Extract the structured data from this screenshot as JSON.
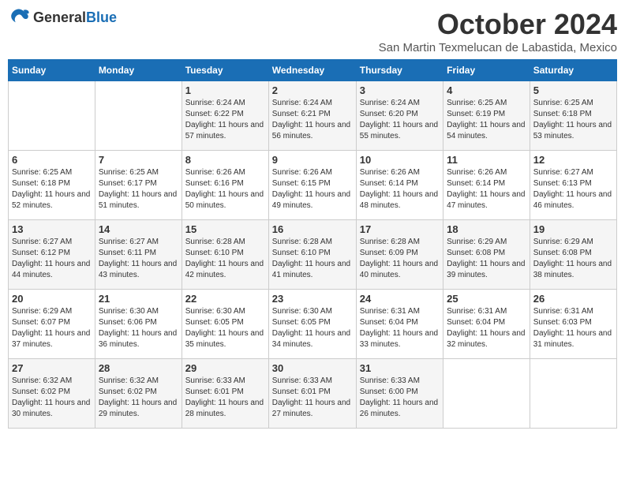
{
  "header": {
    "logo": {
      "general": "General",
      "blue": "Blue"
    },
    "month_year": "October 2024",
    "location": "San Martin Texmelucan de Labastida, Mexico"
  },
  "days_of_week": [
    "Sunday",
    "Monday",
    "Tuesday",
    "Wednesday",
    "Thursday",
    "Friday",
    "Saturday"
  ],
  "weeks": [
    [
      {
        "day": null,
        "info": null
      },
      {
        "day": null,
        "info": null
      },
      {
        "day": "1",
        "info": "Sunrise: 6:24 AM\nSunset: 6:22 PM\nDaylight: 11 hours and 57 minutes."
      },
      {
        "day": "2",
        "info": "Sunrise: 6:24 AM\nSunset: 6:21 PM\nDaylight: 11 hours and 56 minutes."
      },
      {
        "day": "3",
        "info": "Sunrise: 6:24 AM\nSunset: 6:20 PM\nDaylight: 11 hours and 55 minutes."
      },
      {
        "day": "4",
        "info": "Sunrise: 6:25 AM\nSunset: 6:19 PM\nDaylight: 11 hours and 54 minutes."
      },
      {
        "day": "5",
        "info": "Sunrise: 6:25 AM\nSunset: 6:18 PM\nDaylight: 11 hours and 53 minutes."
      }
    ],
    [
      {
        "day": "6",
        "info": "Sunrise: 6:25 AM\nSunset: 6:18 PM\nDaylight: 11 hours and 52 minutes."
      },
      {
        "day": "7",
        "info": "Sunrise: 6:25 AM\nSunset: 6:17 PM\nDaylight: 11 hours and 51 minutes."
      },
      {
        "day": "8",
        "info": "Sunrise: 6:26 AM\nSunset: 6:16 PM\nDaylight: 11 hours and 50 minutes."
      },
      {
        "day": "9",
        "info": "Sunrise: 6:26 AM\nSunset: 6:15 PM\nDaylight: 11 hours and 49 minutes."
      },
      {
        "day": "10",
        "info": "Sunrise: 6:26 AM\nSunset: 6:14 PM\nDaylight: 11 hours and 48 minutes."
      },
      {
        "day": "11",
        "info": "Sunrise: 6:26 AM\nSunset: 6:14 PM\nDaylight: 11 hours and 47 minutes."
      },
      {
        "day": "12",
        "info": "Sunrise: 6:27 AM\nSunset: 6:13 PM\nDaylight: 11 hours and 46 minutes."
      }
    ],
    [
      {
        "day": "13",
        "info": "Sunrise: 6:27 AM\nSunset: 6:12 PM\nDaylight: 11 hours and 44 minutes."
      },
      {
        "day": "14",
        "info": "Sunrise: 6:27 AM\nSunset: 6:11 PM\nDaylight: 11 hours and 43 minutes."
      },
      {
        "day": "15",
        "info": "Sunrise: 6:28 AM\nSunset: 6:10 PM\nDaylight: 11 hours and 42 minutes."
      },
      {
        "day": "16",
        "info": "Sunrise: 6:28 AM\nSunset: 6:10 PM\nDaylight: 11 hours and 41 minutes."
      },
      {
        "day": "17",
        "info": "Sunrise: 6:28 AM\nSunset: 6:09 PM\nDaylight: 11 hours and 40 minutes."
      },
      {
        "day": "18",
        "info": "Sunrise: 6:29 AM\nSunset: 6:08 PM\nDaylight: 11 hours and 39 minutes."
      },
      {
        "day": "19",
        "info": "Sunrise: 6:29 AM\nSunset: 6:08 PM\nDaylight: 11 hours and 38 minutes."
      }
    ],
    [
      {
        "day": "20",
        "info": "Sunrise: 6:29 AM\nSunset: 6:07 PM\nDaylight: 11 hours and 37 minutes."
      },
      {
        "day": "21",
        "info": "Sunrise: 6:30 AM\nSunset: 6:06 PM\nDaylight: 11 hours and 36 minutes."
      },
      {
        "day": "22",
        "info": "Sunrise: 6:30 AM\nSunset: 6:05 PM\nDaylight: 11 hours and 35 minutes."
      },
      {
        "day": "23",
        "info": "Sunrise: 6:30 AM\nSunset: 6:05 PM\nDaylight: 11 hours and 34 minutes."
      },
      {
        "day": "24",
        "info": "Sunrise: 6:31 AM\nSunset: 6:04 PM\nDaylight: 11 hours and 33 minutes."
      },
      {
        "day": "25",
        "info": "Sunrise: 6:31 AM\nSunset: 6:04 PM\nDaylight: 11 hours and 32 minutes."
      },
      {
        "day": "26",
        "info": "Sunrise: 6:31 AM\nSunset: 6:03 PM\nDaylight: 11 hours and 31 minutes."
      }
    ],
    [
      {
        "day": "27",
        "info": "Sunrise: 6:32 AM\nSunset: 6:02 PM\nDaylight: 11 hours and 30 minutes."
      },
      {
        "day": "28",
        "info": "Sunrise: 6:32 AM\nSunset: 6:02 PM\nDaylight: 11 hours and 29 minutes."
      },
      {
        "day": "29",
        "info": "Sunrise: 6:33 AM\nSunset: 6:01 PM\nDaylight: 11 hours and 28 minutes."
      },
      {
        "day": "30",
        "info": "Sunrise: 6:33 AM\nSunset: 6:01 PM\nDaylight: 11 hours and 27 minutes."
      },
      {
        "day": "31",
        "info": "Sunrise: 6:33 AM\nSunset: 6:00 PM\nDaylight: 11 hours and 26 minutes."
      },
      {
        "day": null,
        "info": null
      },
      {
        "day": null,
        "info": null
      }
    ]
  ]
}
